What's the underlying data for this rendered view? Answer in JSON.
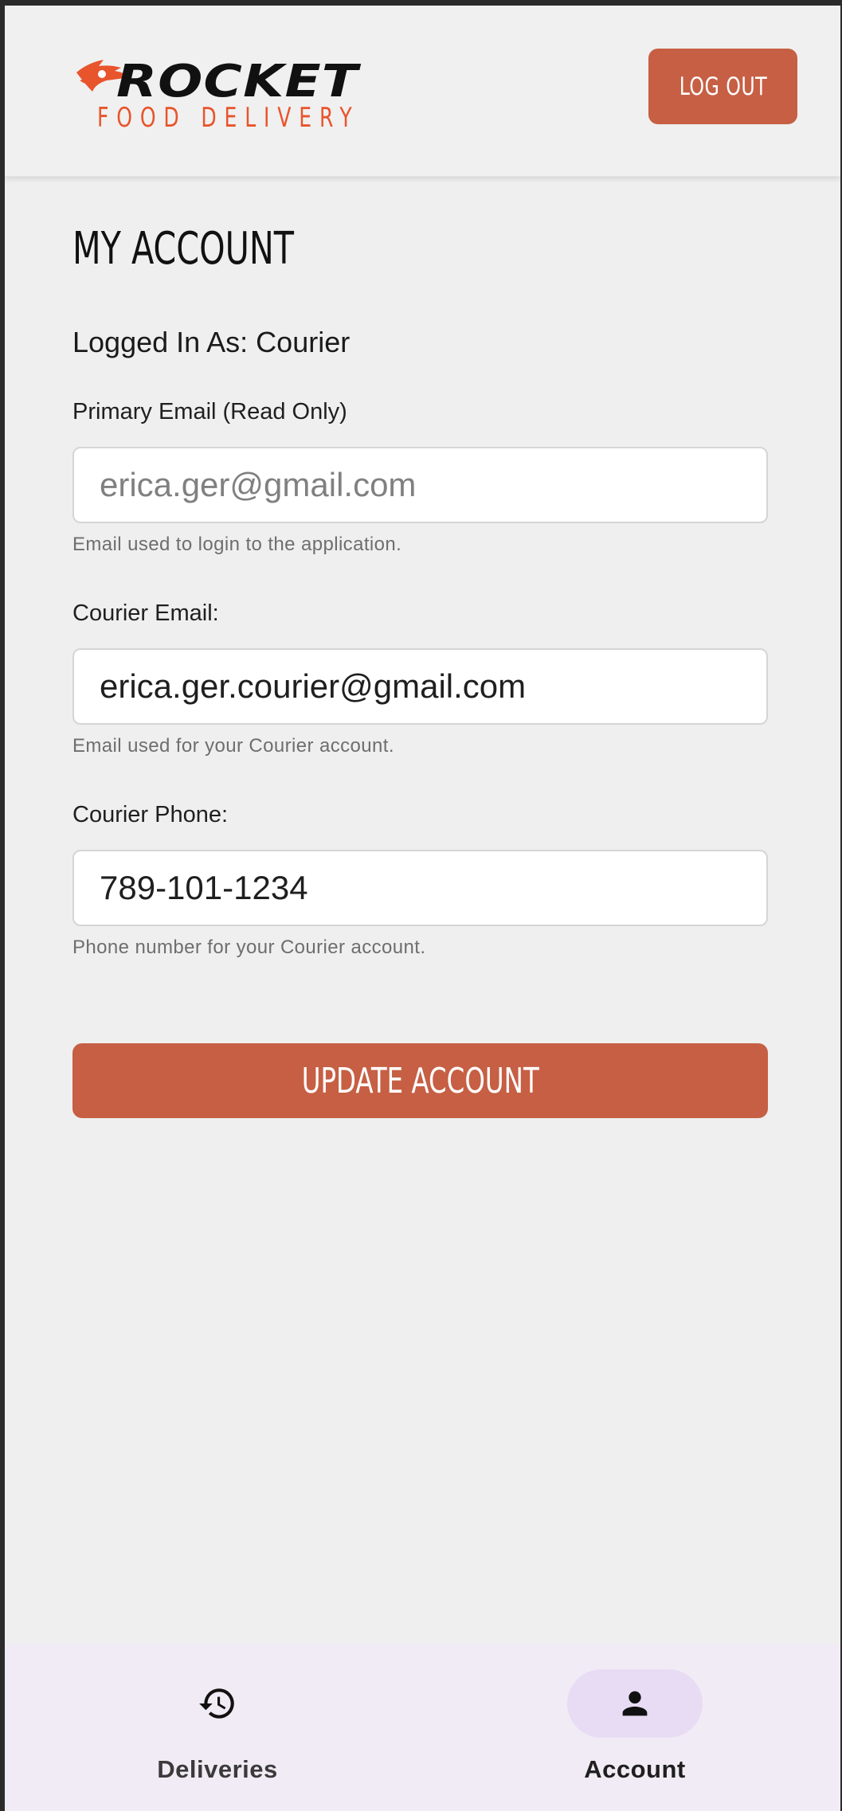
{
  "header": {
    "logo_word": "ROCKET",
    "logo_sub": "FOOD DELIVERY",
    "logout_label": "LOG OUT"
  },
  "account": {
    "title": "MY ACCOUNT",
    "logged_in_as": "Logged In As: Courier",
    "primary_email": {
      "label": "Primary Email (Read Only)",
      "value": "erica.ger@gmail.com",
      "hint": "Email used to login to the application."
    },
    "courier_email": {
      "label": "Courier Email:",
      "value": "erica.ger.courier@gmail.com",
      "hint": "Email used for your Courier account."
    },
    "courier_phone": {
      "label": "Courier Phone:",
      "value": "789-101-1234",
      "hint": "Phone number for your Courier account."
    },
    "update_label": "UPDATE ACCOUNT"
  },
  "bottom_nav": {
    "items": [
      {
        "label": "Deliveries",
        "icon": "history-icon",
        "active": false
      },
      {
        "label": "Account",
        "icon": "person-icon",
        "active": true
      }
    ]
  },
  "colors": {
    "accent": "#c65f44",
    "logo_orange": "#e8542c",
    "nav_background": "#f1ebf5",
    "nav_active_pill": "#e8dcf4"
  }
}
